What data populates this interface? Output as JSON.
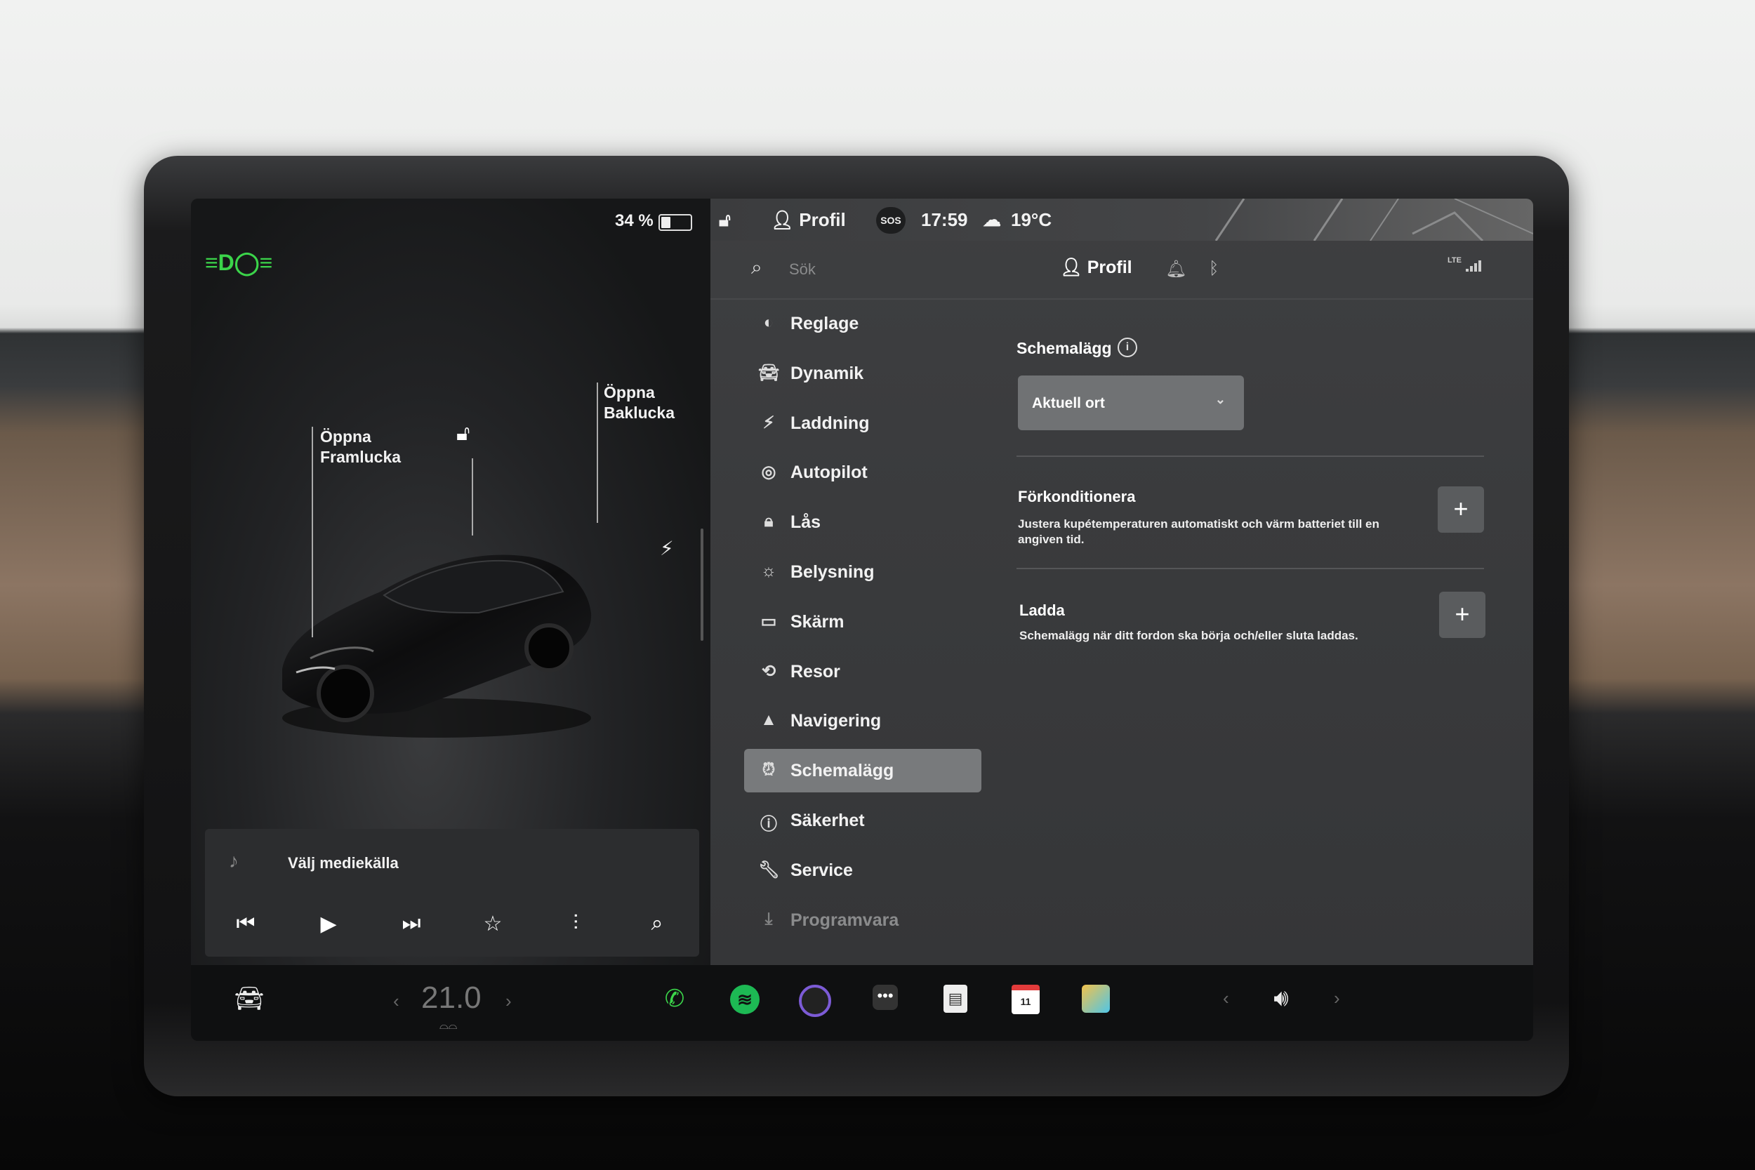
{
  "status": {
    "battery_pct": "34 %",
    "battery_level": 0.34,
    "profile": "Profil",
    "sos": "SOS",
    "time": "17:59",
    "temperature": "19°C"
  },
  "car_view": {
    "front_trunk": "Öppna\nFramlucka",
    "rear_trunk": "Öppna\nBaklucka",
    "icons": [
      "headlight-icon",
      "unlock-icon",
      "charge-icon"
    ]
  },
  "header": {
    "search_placeholder": "Sök",
    "profile_label": "Profil",
    "network": "LTE"
  },
  "menu": {
    "items": [
      {
        "label": "Reglage",
        "icon": "toggle-icon"
      },
      {
        "label": "Dynamik",
        "icon": "car-icon"
      },
      {
        "label": "Laddning",
        "icon": "bolt-icon"
      },
      {
        "label": "Autopilot",
        "icon": "steering-wheel-icon"
      },
      {
        "label": "Lås",
        "icon": "lock-icon"
      },
      {
        "label": "Belysning",
        "icon": "sun-icon"
      },
      {
        "label": "Skärm",
        "icon": "display-icon"
      },
      {
        "label": "Resor",
        "icon": "trips-icon"
      },
      {
        "label": "Navigering",
        "icon": "navigation-icon"
      },
      {
        "label": "Schemalägg",
        "icon": "alarm-clock-icon"
      },
      {
        "label": "Säkerhet",
        "icon": "info-circle-icon"
      },
      {
        "label": "Service",
        "icon": "wrench-icon"
      },
      {
        "label": "Programvara",
        "icon": "download-icon"
      }
    ],
    "active": "Schemalägg"
  },
  "schedule": {
    "title": "Schemalägg",
    "location_value": "Aktuell ort",
    "precondition_title": "Förkonditionera",
    "precondition_desc": "Justera kupétemperaturen automatiskt och värm batteriet till en angiven tid.",
    "charge_title": "Ladda",
    "charge_desc": "Schemalägg när ditt fordon ska börja och/eller sluta laddas."
  },
  "media": {
    "source_label": "Välj mediekälla"
  },
  "dock": {
    "cabin_temp": "21.0",
    "apps": [
      "phone-icon",
      "spotify-icon",
      "camera-icon",
      "more-icon",
      "notepad-icon",
      "calendar-icon",
      "toybox-icon"
    ],
    "calendar_day": "11"
  },
  "colors": {
    "accent_green": "#3bd44a",
    "spotify_green": "#1db954",
    "active_menu": "#787a7c"
  }
}
